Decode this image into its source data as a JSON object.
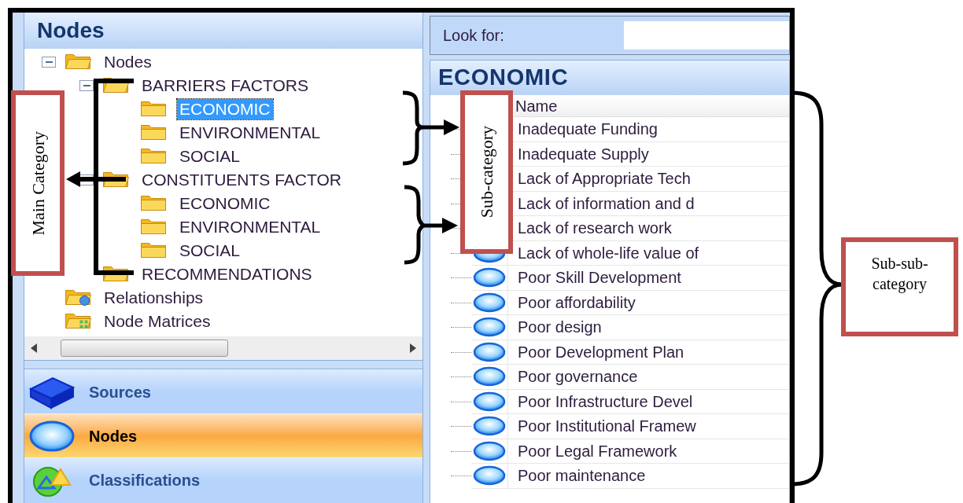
{
  "navigation_pane": {
    "title": "Nodes",
    "tree": [
      {
        "label": "Nodes",
        "kind": "open-folder",
        "selected": false,
        "expanded": true,
        "children": [
          {
            "label": "BARRIERS FACTORS",
            "kind": "open-folder",
            "selected": false,
            "expanded": true,
            "children": [
              {
                "label": "ECONOMIC",
                "kind": "folder",
                "selected": true
              },
              {
                "label": "ENVIRONMENTAL",
                "kind": "folder",
                "selected": false
              },
              {
                "label": "SOCIAL",
                "kind": "folder",
                "selected": false
              }
            ]
          },
          {
            "label": "CONSTITUENTS FACTOR",
            "kind": "open-folder",
            "selected": false,
            "expanded": true,
            "children": [
              {
                "label": "ECONOMIC",
                "kind": "folder",
                "selected": false
              },
              {
                "label": "ENVIRONMENTAL",
                "kind": "folder",
                "selected": false
              },
              {
                "label": "SOCIAL",
                "kind": "folder",
                "selected": false
              }
            ]
          },
          {
            "label": "RECOMMENDATIONS",
            "kind": "open-folder",
            "selected": false
          }
        ]
      },
      {
        "label": "Relationships",
        "kind": "relationships",
        "selected": false
      },
      {
        "label": "Node Matrices",
        "kind": "matrices",
        "selected": false
      }
    ],
    "buttons": [
      {
        "label": "Sources",
        "kind": "sources",
        "selected": false
      },
      {
        "label": "Nodes",
        "kind": "nodes",
        "selected": true
      },
      {
        "label": "Classifications",
        "kind": "classifications",
        "selected": false
      }
    ]
  },
  "search": {
    "label": "Look for:"
  },
  "list_view": {
    "title": "ECONOMIC",
    "columns": [
      "Name"
    ],
    "rows": [
      "Inadequate Funding",
      "Inadequate Supply",
      "Lack of Appropriate Tech",
      "Lack of information and d",
      "Lack of research work",
      "Lack of whole-life value of",
      "Poor  Skill Development",
      "Poor affordability",
      "Poor design",
      "Poor Development Plan",
      "Poor governance",
      "Poor Infrastructure Devel",
      "Poor Institutional Framew",
      "Poor Legal Framework",
      "Poor maintenance"
    ]
  },
  "annotations": [
    "Main Category",
    "Sub-category",
    "Sub-sub-category"
  ]
}
